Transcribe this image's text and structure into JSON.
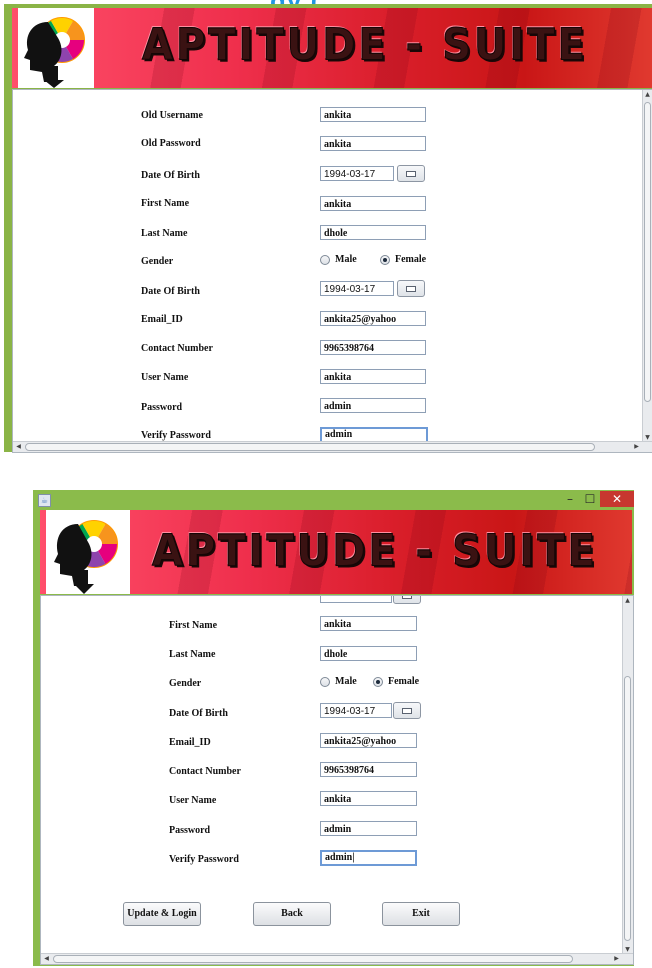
{
  "cut_heading": "gy (",
  "banner_title": "APTITUDE - SUITE",
  "screen1": {
    "form": {
      "rows": [
        {
          "label": "Old  Username",
          "value": "ankita"
        },
        {
          "label": "Old Password",
          "value": "ankita"
        },
        {
          "label": "Date Of Birth",
          "value": "1994-03-17"
        },
        {
          "label": "First Name",
          "value": "ankita"
        },
        {
          "label": "Last Name",
          "value": "dhole"
        },
        {
          "label": "Gender"
        },
        {
          "label": "Date Of Birth",
          "value": "1994-03-17"
        },
        {
          "label": "Email_ID",
          "value": "ankita25@yahoo"
        },
        {
          "label": "Contact Number",
          "value": "9965398764"
        },
        {
          "label": "User Name",
          "value": "ankita"
        },
        {
          "label": "Password",
          "value": "admin"
        },
        {
          "label": "Verify Password",
          "value": "admin"
        }
      ],
      "gender_options": [
        "Male",
        "Female"
      ],
      "gender_selected": "Female"
    }
  },
  "screen2": {
    "window_buttons": {
      "minimize": "–",
      "maximize": "☐",
      "close": "✕"
    },
    "form": {
      "rows": [
        {
          "label": "First Name",
          "value": "ankita"
        },
        {
          "label": "Last Name",
          "value": "dhole"
        },
        {
          "label": "Gender"
        },
        {
          "label": "Date Of Birth",
          "value": "1994-03-17"
        },
        {
          "label": "Email_ID",
          "value": "ankita25@yahoo"
        },
        {
          "label": "Contact Number",
          "value": "9965398764"
        },
        {
          "label": "User Name",
          "value": "ankita"
        },
        {
          "label": "Password",
          "value": "admin"
        },
        {
          "label": "Verify Password",
          "value": "admin|"
        }
      ],
      "gender_options": [
        "Male",
        "Female"
      ],
      "gender_selected": "Female"
    },
    "buttons": {
      "update": "Update & Login",
      "back": "Back",
      "exit": "Exit"
    }
  },
  "colors": {
    "window_frame": "#8bbb4b",
    "banner_red": "#e52b3d",
    "heading_blue": "#2196e0"
  }
}
